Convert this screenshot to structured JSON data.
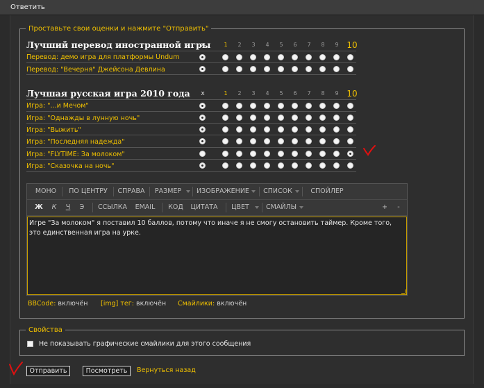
{
  "window": {
    "title": "Ответить"
  },
  "rating": {
    "legend": "Проставьте свои оценки и нажмите \"Отправить\"",
    "columns": [
      "x",
      "1",
      "2",
      "3",
      "4",
      "5",
      "6",
      "7",
      "8",
      "9",
      "10"
    ],
    "categories": [
      {
        "title": "Лучший перевод иностранной игры",
        "items": [
          {
            "label": "Перевод: демо игра для платформы Undum",
            "selected": "x"
          },
          {
            "label": "Перевод: \"Вечерня\" Джейсона Девлина",
            "selected": "x"
          }
        ]
      },
      {
        "title": "Лучшая русская игра 2010 года",
        "items": [
          {
            "label": "Игра: \"...и Мечом\"",
            "selected": "x"
          },
          {
            "label": "Игра: \"Однажды в лунную ночь\"",
            "selected": "x"
          },
          {
            "label": "Игра: \"Выжить\"",
            "selected": "x"
          },
          {
            "label": "Игра: \"Последняя надежда\"",
            "selected": "x"
          },
          {
            "label": "Игра: \"FLYTIME: За молоком\"",
            "selected": "10"
          },
          {
            "label": "Игра: \"Сказочка на ночь\"",
            "selected": "x"
          }
        ]
      }
    ]
  },
  "editor": {
    "toolbar1": [
      "МОНО",
      "ПО ЦЕНТРУ",
      "СПРАВА",
      "РАЗМЕР",
      "ИЗОБРАЖЕНИЕ",
      "СПИСОК",
      "СПОЙЛЕР"
    ],
    "toolbar2": [
      "Ж",
      "К",
      "Ч",
      "Э",
      "ССЫЛКА",
      "EMAIL",
      "КОД",
      "ЦИТАТА",
      "ЦВЕТ",
      "СМАЙЛЫ",
      "+",
      "-"
    ],
    "text": "Игре \"За молоком\" я поставил 10 баллов, потому что иначе я не смогу остановить таймер. Кроме того, это единственная игра на урке."
  },
  "status": {
    "bbcode_label": "BBCode:",
    "bbcode_value": "включён",
    "img_label": "[img] тег:",
    "img_value": "включён",
    "smilies_label": "Смайлики:",
    "smilies_value": "включён"
  },
  "properties": {
    "legend": "Свойства",
    "disable_smilies_label": "Не показывать графические смайлики для этого сообщения"
  },
  "buttons": {
    "submit": "Отправить",
    "preview": "Посмотреть",
    "back": "Вернуться назад"
  }
}
